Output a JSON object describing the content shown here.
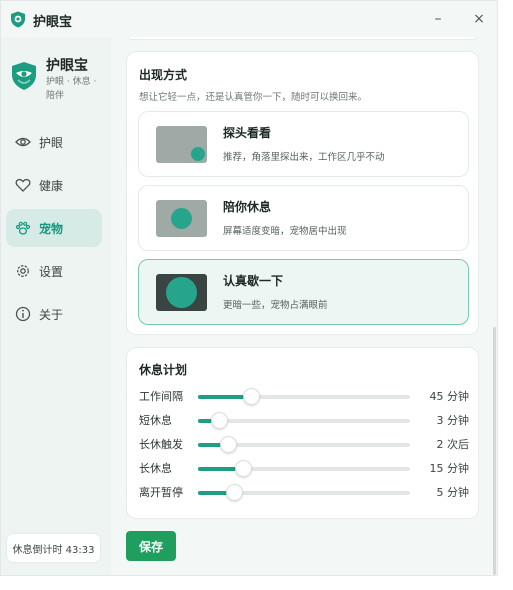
{
  "app": {
    "title": "护眼宝"
  },
  "window_controls": {
    "minimize": "–",
    "close": "×"
  },
  "brand": {
    "name": "护眼宝",
    "subtitle": "护眼 · 休息 · 陪伴"
  },
  "sidebar": {
    "items": [
      {
        "label": "护眼",
        "icon": "eye-icon",
        "active": false
      },
      {
        "label": "健康",
        "icon": "heart-icon",
        "active": false
      },
      {
        "label": "宠物",
        "icon": "paw-icon",
        "active": true
      },
      {
        "label": "设置",
        "icon": "gear-icon",
        "active": false
      },
      {
        "label": "关于",
        "icon": "info-icon",
        "active": false
      }
    ],
    "countdown": "休息倒计时 43:33"
  },
  "appearance": {
    "title": "出现方式",
    "description": "想让它轻一点，还是认真管你一下，随时可以换回来。",
    "options": [
      {
        "title": "探头看看",
        "desc": "推荐，角落里探出来，工作区几乎不动",
        "selected": false
      },
      {
        "title": "陪你休息",
        "desc": "屏幕适度变暗，宠物居中出现",
        "selected": false
      },
      {
        "title": "认真歇一下",
        "desc": "更暗一些，宠物占满眼前",
        "selected": true
      }
    ]
  },
  "plan": {
    "title": "休息计划",
    "rows": [
      {
        "label": "工作间隔",
        "value": "45 分钟",
        "level": 0.25
      },
      {
        "label": "短休息",
        "value": "3 分钟",
        "level": 0.1
      },
      {
        "label": "长休触发",
        "value": "2 次后",
        "level": 0.14
      },
      {
        "label": "长休息",
        "value": "15 分钟",
        "level": 0.21
      },
      {
        "label": "离开暂停",
        "value": "5 分钟",
        "level": 0.17
      }
    ]
  },
  "save_label": "保存",
  "colors": {
    "accent": "#1f9e84",
    "save": "#1f9e5e",
    "active_bg": "#d6ebe6"
  }
}
